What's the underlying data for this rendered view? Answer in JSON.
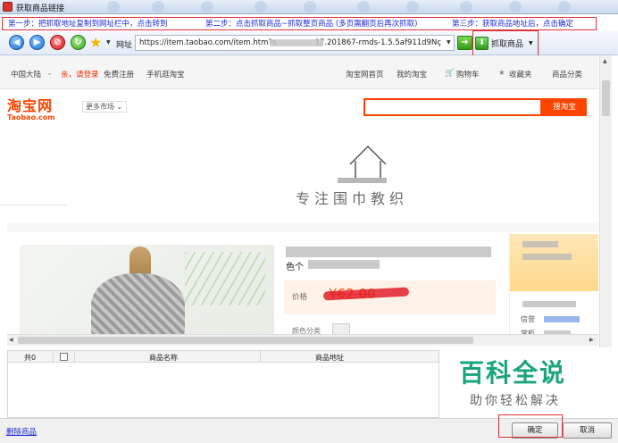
{
  "window": {
    "title": "获取商品链接"
  },
  "steps": {
    "step1": "第一步：把抓取地址复制到网址栏中，点击转到",
    "step2": "第二步：点击抓取商品~抓取整页商品 (多页需翻页后再次抓取)",
    "step3": "第三步：获取商品地址后，点击确定"
  },
  "toolbar": {
    "address_label": "网址",
    "address_value": "https://item.taobao.com/item.htm?s                17.201867-rmds-1.5.5af911d9Nç",
    "grab_label": "抓取商品"
  },
  "taobao": {
    "region": "中国大陆",
    "greeting": "亲，请登录",
    "register": "免费注册",
    "mobile": "手机逛淘宝",
    "home": "淘宝网首页",
    "my_taobao": "我的淘宝",
    "cart": "购物车",
    "favorites": "收藏夹",
    "categories": "商品分类",
    "logo_cn": "淘宝网",
    "logo_en": "Taobao.com",
    "more_market": "更多市场",
    "search_button": "搜淘宝",
    "shop_slogan": "专注围巾教织",
    "product_title": "色个",
    "price_label": "价格",
    "price_value": "¥62.00",
    "color_label": "颜色分类",
    "side_label_1": "信誉",
    "side_label_2": "掌柜"
  },
  "list": {
    "count_label": "共0",
    "col_name": "商品名称",
    "col_url": "商品地址"
  },
  "watermark": {
    "title": "百科全说",
    "subtitle": "助你轻松解决"
  },
  "bottom": {
    "delete": "删除商品",
    "ok": "确定",
    "cancel": "取消"
  }
}
